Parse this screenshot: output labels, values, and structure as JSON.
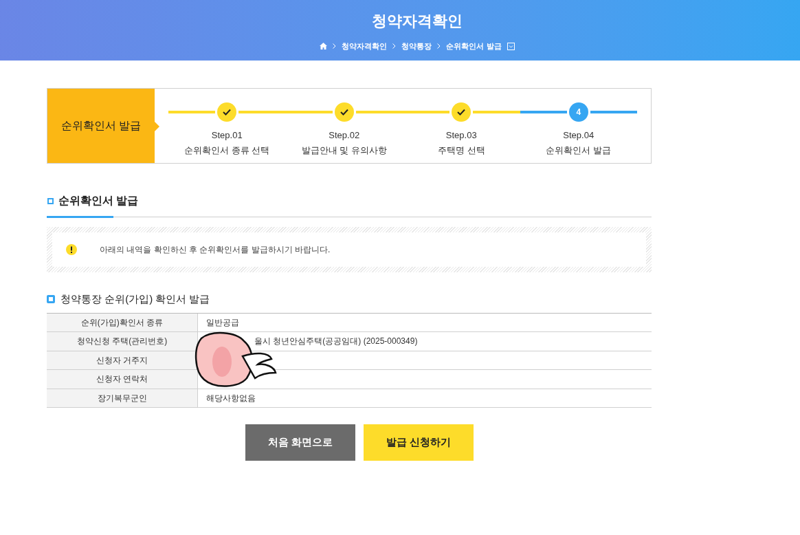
{
  "header": {
    "title": "청약자격확인",
    "breadcrumb": [
      "청약자격확인",
      "청약통장",
      "순위확인서 발급"
    ]
  },
  "stepper": {
    "title": "순위확인서 발급",
    "steps": [
      {
        "label": "Step.01",
        "caption": "순위확인서 종류 선택",
        "done": true
      },
      {
        "label": "Step.02",
        "caption": "발급안내 및 유의사항",
        "done": true
      },
      {
        "label": "Step.03",
        "caption": "주택명 선택",
        "done": true
      },
      {
        "label": "Step.04",
        "caption": "순위확인서 발급",
        "done": false,
        "number": "4"
      }
    ]
  },
  "section": {
    "title": "순위확인서 발급",
    "notice": "아래의 내역을 확인하신 후 순위확인서를 발급하시기 바랍니다."
  },
  "table": {
    "title": "청약통장 순위(가입) 확인서 발급",
    "rows": [
      {
        "label": "순위(가입)확인서 종류",
        "value": "일반공급"
      },
      {
        "label": "청약신청 주택(관리번호)",
        "value": "울시 청년안심주택(공공임대) (2025-000349)"
      },
      {
        "label": "신청자 거주지"
      },
      {
        "label": "신청자 연락처"
      },
      {
        "label": "장기복무군인",
        "value": "해당사항없음"
      }
    ]
  },
  "buttons": [
    {
      "label": "처음 화면으로",
      "kind": "secondary"
    },
    {
      "label": "발급 신청하기",
      "kind": "primary"
    }
  ]
}
